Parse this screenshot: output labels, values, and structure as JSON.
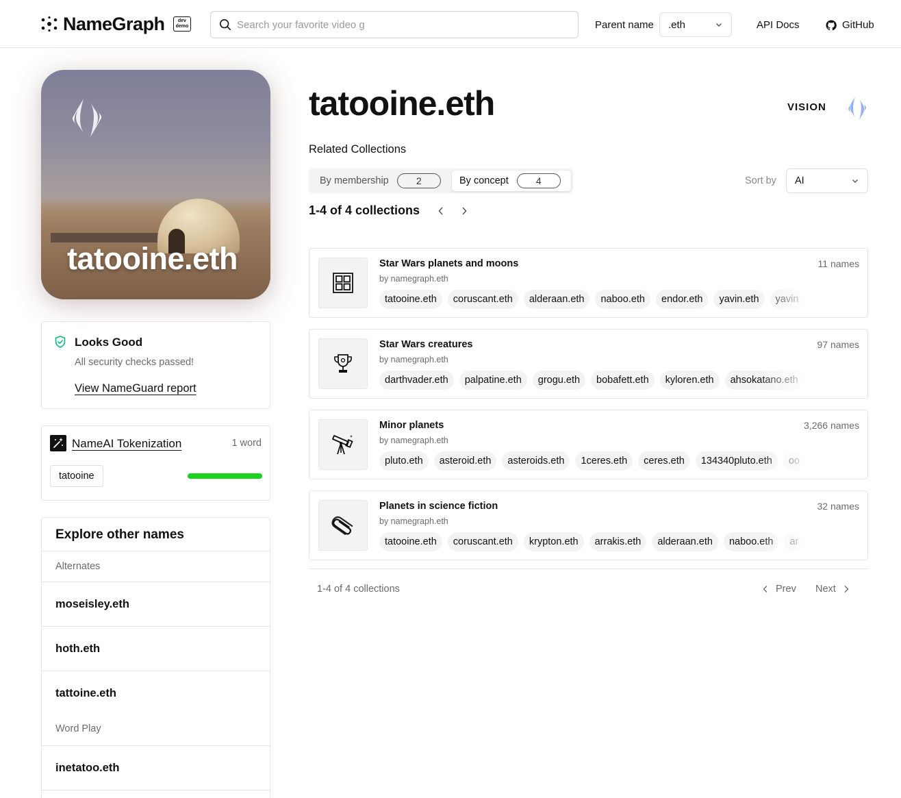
{
  "header": {
    "logo_text": "NameGraph",
    "badge_line1": "dev",
    "badge_line2": "demo",
    "search_placeholder": "Search your favorite video g",
    "parent_label": "Parent name",
    "parent_value": ".eth",
    "api_docs": "API Docs",
    "github": "GitHub"
  },
  "avatar": {
    "name": "tatooine.eth"
  },
  "nameguard": {
    "title": "Looks Good",
    "subtitle": "All security checks passed!",
    "link": "View NameGuard report",
    "status_color": "#10b981"
  },
  "tokenization": {
    "title": "NameAI Tokenization",
    "count": "1 word",
    "token": "tatooine",
    "bar_color": "#1ed11e"
  },
  "explore": {
    "title": "Explore other names",
    "sections": [
      {
        "label": "Alternates",
        "names": [
          "moseisley.eth",
          "hoth.eth",
          "tattoine.eth"
        ]
      },
      {
        "label": "Word Play",
        "names": [
          "inetatoo.eth"
        ]
      }
    ]
  },
  "main": {
    "title": "tatooine.eth",
    "vision_logo": "VISION",
    "related_label": "Related Collections",
    "tabs": [
      {
        "label": "By membership",
        "count": "2",
        "active": false
      },
      {
        "label": "By concept",
        "count": "4",
        "active": true
      }
    ],
    "sort_label": "Sort by",
    "sort_value": "AI",
    "range_label": "1-4 of 4 collections",
    "collections": [
      {
        "title": "Star Wars planets and moons",
        "by": "by namegraph.eth",
        "count": "11 names",
        "icon": "grid-icon",
        "names": [
          "tatooine.eth",
          "coruscant.eth",
          "alderaan.eth",
          "naboo.eth",
          "endor.eth",
          "yavin.eth",
          "yavin"
        ]
      },
      {
        "title": "Star Wars creatures",
        "by": "by namegraph.eth",
        "count": "97 names",
        "icon": "trophy-icon",
        "names": [
          "darthvader.eth",
          "palpatine.eth",
          "grogu.eth",
          "bobafett.eth",
          "kyloren.eth",
          "ahsokatano.eth"
        ]
      },
      {
        "title": "Minor planets",
        "by": "by namegraph.eth",
        "count": "3,266 names",
        "icon": "telescope-icon",
        "names": [
          "pluto.eth",
          "asteroid.eth",
          "asteroids.eth",
          "1ceres.eth",
          "ceres.eth",
          "134340pluto.eth",
          "oo"
        ]
      },
      {
        "title": "Planets in science fiction",
        "by": "by namegraph.eth",
        "count": "32 names",
        "icon": "paperclip-icon",
        "names": [
          "tatooine.eth",
          "coruscant.eth",
          "krypton.eth",
          "arrakis.eth",
          "alderaan.eth",
          "naboo.eth",
          "ar"
        ]
      }
    ],
    "bottom_range": "1-4 of 4 collections",
    "prev": "Prev",
    "next": "Next"
  }
}
